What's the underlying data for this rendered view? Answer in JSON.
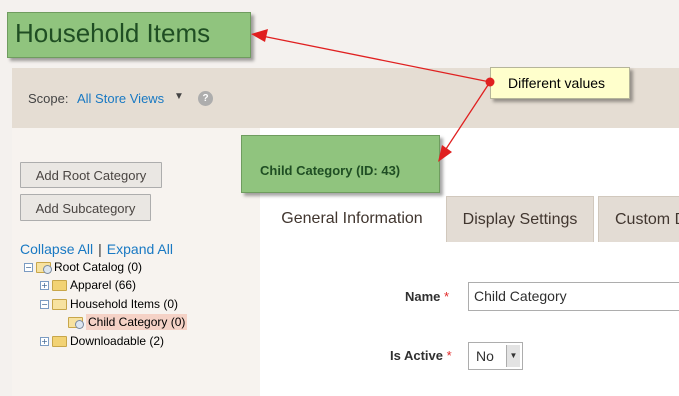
{
  "annotations": {
    "title_box": "Household Items",
    "child_box": "Child Category (ID: 43)",
    "note": "Different values"
  },
  "scope": {
    "label": "Scope:",
    "value": "All Store Views",
    "caret": "▼",
    "help": "?"
  },
  "buttons": {
    "add_root": "Add Root Category",
    "add_sub": "Add Subcategory"
  },
  "tree": {
    "collapse_all": "Collapse All",
    "separator": "|",
    "expand_all": "Expand All",
    "nodes": [
      {
        "label": "Root Catalog (0)",
        "expander": "−"
      },
      {
        "label": "Apparel (66)",
        "expander": "+"
      },
      {
        "label": "Household Items (0)",
        "expander": "−"
      },
      {
        "label": "Child Category (0)",
        "expander": ""
      },
      {
        "label": "Downloadable (2)",
        "expander": "+"
      }
    ]
  },
  "tabs": [
    {
      "label": "General Information",
      "active": true
    },
    {
      "label": "Display Settings",
      "active": false
    },
    {
      "label": "Custom D",
      "active": false
    }
  ],
  "form": {
    "name_label": "Name",
    "name_value": "Child Category",
    "active_label": "Is Active",
    "active_value": "No",
    "required_mark": "*"
  },
  "colors": {
    "link": "#1979c3",
    "callout_green": "#90c47e",
    "note_yellow": "#ffffcc",
    "arrow_red": "#e02020"
  }
}
